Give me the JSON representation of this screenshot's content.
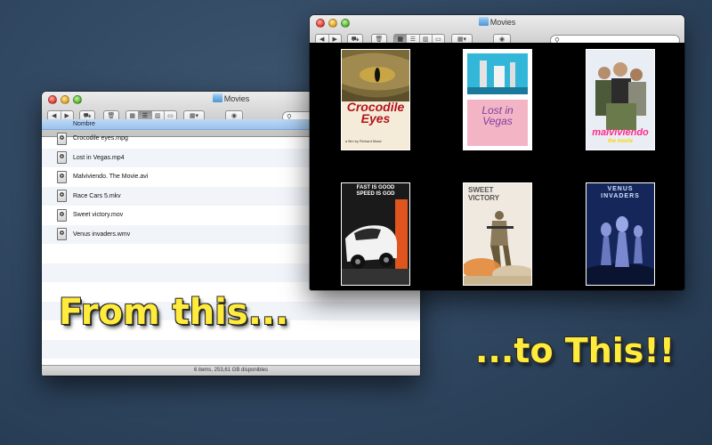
{
  "list_window": {
    "title": "Movies",
    "column_header": "Nombre",
    "files": [
      {
        "name": "Crocodile eyes.mpg"
      },
      {
        "name": "Lost in Vegas.mp4"
      },
      {
        "name": "Malviviendo. The Movie.avi"
      },
      {
        "name": "Race Cars 5.mkv"
      },
      {
        "name": "Sweet victory.mov"
      },
      {
        "name": "Venus invaders.wmv"
      }
    ],
    "status": "6 items, 253,61 GB disponibles"
  },
  "cover_window": {
    "title": "Movies",
    "posters": [
      {
        "icon": "crocodile-eye",
        "title_line1": "Crocodile",
        "title_line2": "Eyes",
        "credit": "a film by Richard Mase"
      },
      {
        "icon": "vegas-skyline",
        "title_line1": "Lost in",
        "title_line2": "Vegas"
      },
      {
        "icon": "group-photo",
        "title_line1": "malviviendo",
        "title_line2": "the movie"
      },
      {
        "icon": "sports-car",
        "tagline_1": "FAST IS GOOD",
        "tagline_2": "SPEED IS GOD"
      },
      {
        "icon": "soldier",
        "title_line1": "SWEET",
        "title_line2": "VICTORY"
      },
      {
        "icon": "aliens",
        "title_line1": "VENUS",
        "title_line2": "INVADERS"
      }
    ]
  },
  "captions": {
    "left": "From this...",
    "right": "...to This!!"
  },
  "colors": {
    "background": "#2f4660",
    "caption": "#ffeb3b",
    "list_header": "#9cc3ec"
  }
}
